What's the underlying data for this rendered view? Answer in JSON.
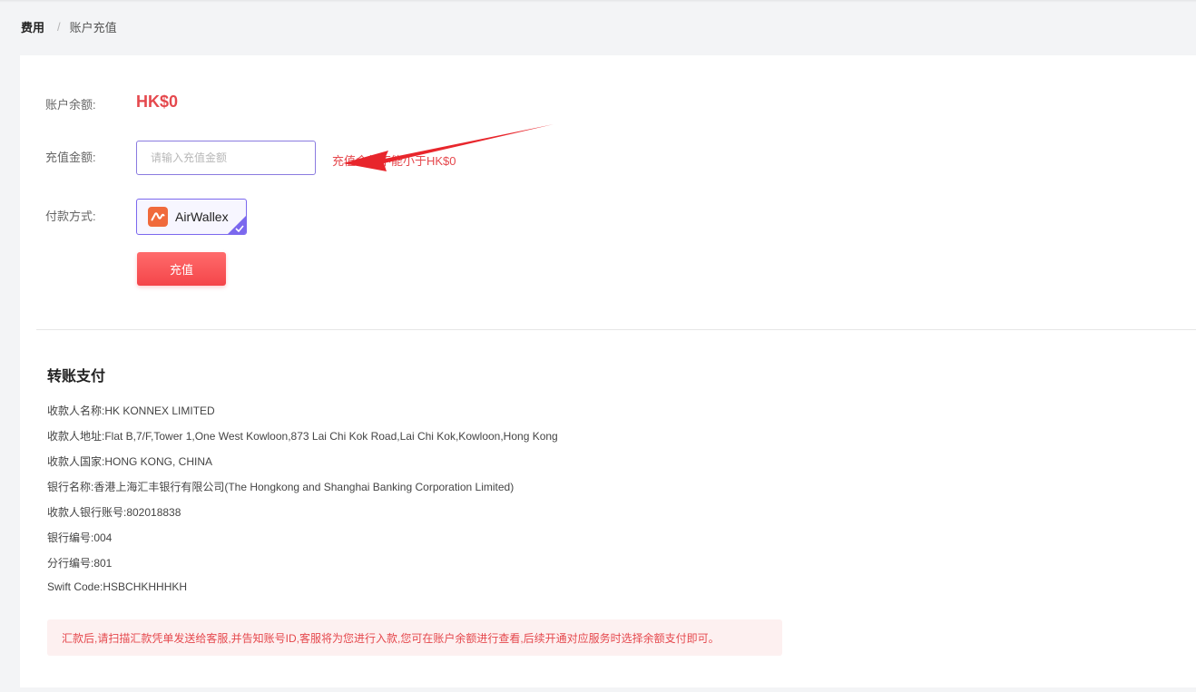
{
  "breadcrumb": {
    "root": "费用",
    "separator": "/",
    "current": "账户充值"
  },
  "recharge": {
    "balance_label": "账户余额:",
    "balance_value": "HK$0",
    "amount_label": "充值金额:",
    "amount_placeholder": "请输入充值金额",
    "amount_value": "",
    "min_hint": "充值金额不能小于HK$0",
    "payment_label": "付款方式:",
    "payment_option": "AirWallex",
    "submit_label": "充值"
  },
  "transfer": {
    "title": "转账支付",
    "lines": [
      "收款人名称:HK KONNEX LIMITED",
      "收款人地址:Flat B,7/F,Tower 1,One West Kowloon,873 Lai Chi Kok Road,Lai Chi Kok,Kowloon,Hong Kong",
      "收款人国家:HONG KONG, CHINA",
      "银行名称:香港上海汇丰银行有限公司(The Hongkong and Shanghai Banking Corporation Limited)",
      "收款人银行账号:802018838",
      "银行编号:004",
      "分行编号:801",
      "Swift Code:HSBCHKHHHKH"
    ],
    "notice": "汇款后,请扫描汇款凭单发送给客服,并告知账号ID,客服将为您进行入款,您可在账户余额进行查看,后续开通对应服务时选择余额支付即可。"
  },
  "colors": {
    "accent_red": "#e5484d",
    "accent_purple": "#7b68ee",
    "airwallex_orange": "#f06a3c"
  },
  "icons": {
    "payment_logo": "airwallex-logo-icon",
    "selected": "checkmark-icon",
    "annotation": "red-arrow-annotation"
  }
}
